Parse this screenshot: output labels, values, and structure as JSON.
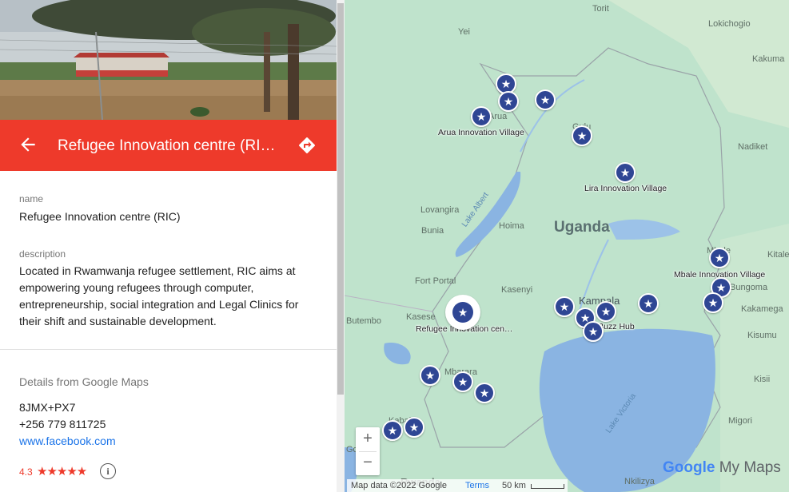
{
  "panel": {
    "title": "Refugee Innovation centre (RI…",
    "fields": {
      "name_label": "name",
      "name_value": "Refugee Innovation centre (RIC)",
      "description_label": "description",
      "description_value": "Located in Rwamwanja refugee settlement, RIC aims at empowering young refugees through computer, entrepreneurship, social integration and Legal Clinics for their shift and sustainable development."
    },
    "details": {
      "heading": "Details from Google Maps",
      "plus_code": "8JMX+PX7",
      "phone": "+256 779 811725",
      "website": "www.facebook.com",
      "rating": "4.3",
      "stars": "★★★★★"
    },
    "accent_color": "#ee3a2b"
  },
  "map": {
    "country": "Uganda",
    "places": [
      "Torit",
      "Yei",
      "Lokichogio",
      "Kakuma",
      "Arua",
      "Gulu",
      "Nadiket",
      "Lovangira",
      "Bunia",
      "Hoima",
      "Fort Portal",
      "Kasenyi",
      "Butembo",
      "Kasese",
      "Kampala",
      "Mbale",
      "Kitale",
      "Bungoma",
      "Kakamega",
      "Kisumu",
      "Kisii",
      "Migori",
      "Mbarara",
      "Kabale",
      "Goma",
      "Rwanda",
      "Nkilizya"
    ],
    "lakes": [
      "Lake Albert",
      "Lake Victoria"
    ],
    "marker_labels": [
      "Arua Innovation Village",
      "Lira Innovation Village",
      "Refugee Innovation cen…",
      "TechBuzz Hub",
      "Mbale Innovation Village"
    ],
    "marker_icon": "star-icon",
    "zoom_in": "+",
    "zoom_out": "−",
    "attribution": "Map data ©2022 Google",
    "terms": "Terms",
    "scale": "50 km",
    "brand_google": "Google",
    "brand_mymaps": "My Maps",
    "marker_color": "#2f4694"
  }
}
